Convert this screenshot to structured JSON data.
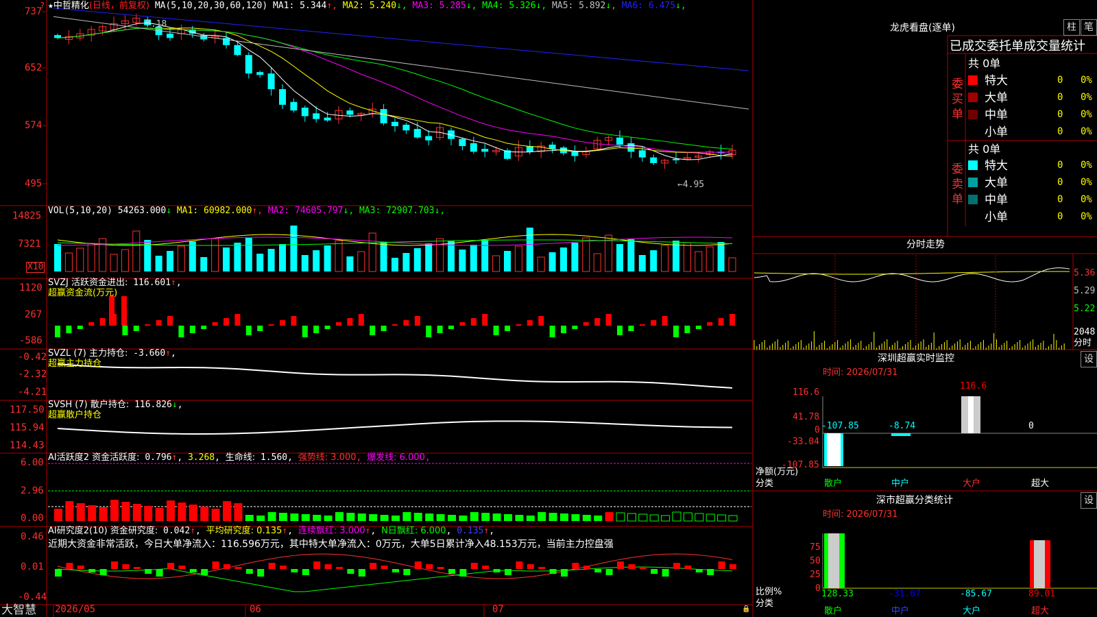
{
  "stock": {
    "star": "★",
    "name": "中哲精化",
    "mode": "(日线，前复权)"
  },
  "ma_header": {
    "label": "MA(5,10,20,30,60,120)",
    "items": [
      {
        "name": "MA1:",
        "value": "5.344",
        "arrow": "↑",
        "color": "#ffffff"
      },
      {
        "name": "MA2:",
        "value": "5.240",
        "arrow": "↓",
        "color": "#ffff00"
      },
      {
        "name": "MA3:",
        "value": "5.285",
        "arrow": "↓",
        "color": "#ff00ff"
      },
      {
        "name": "MA4:",
        "value": "5.326",
        "arrow": "↓",
        "color": "#00ff00"
      },
      {
        "name": "MA5:",
        "value": "5.892",
        "arrow": "↓",
        "color": "#c0c0c0"
      },
      {
        "name": "MA6:",
        "value": "6.475",
        "arrow": "↓",
        "color": "#2222ff"
      }
    ]
  },
  "price_axis": [
    "737",
    "652",
    "574",
    "495"
  ],
  "price_marks": {
    "high": "7.18",
    "low": "←4.95"
  },
  "vol_header": {
    "label": "VOL(5,10,20)",
    "value": "54263.000",
    "arrow": "↓",
    "items": [
      {
        "name": "MA1:",
        "value": "60982.000",
        "arrow": "↑",
        "color": "#ffff00"
      },
      {
        "name": "MA2:",
        "value": "74605.797",
        "arrow": "↓",
        "color": "#ff00ff"
      },
      {
        "name": "MA3:",
        "value": "72907.703",
        "arrow": "↓",
        "color": "#00ff00"
      }
    ]
  },
  "vol_axis": [
    "14825",
    "7321",
    "X10"
  ],
  "svzj": {
    "line1_label": "SVZJ  活跃资金进出:",
    "line1_value": "116.601",
    "line1_arrow": "↑",
    "line2": "超赢资金流(万元)",
    "axis": [
      "1120",
      "267",
      "-586"
    ]
  },
  "svzl": {
    "label": "SVZL (7) 主力持仓:",
    "value": "-3.660",
    "arrow": "↑",
    "line2": "超赢主力持仓",
    "axis": [
      "-0.42",
      "-2.32",
      "-4.21"
    ]
  },
  "svsh": {
    "label": "SVSH (7) 散户持仓:",
    "value": "116.826",
    "arrow": "↓",
    "line2": "超赢散户持仓",
    "axis": [
      "117.50",
      "115.94",
      "114.43"
    ]
  },
  "ai1": {
    "label": "AI活跃度2 资金活跃度:",
    "v1": "0.796",
    "v2": "3.268",
    "v3_label": "生命线:",
    "v3": "1.560",
    "v4": "强势线: 3.000",
    "v5": "爆发线: 6.000",
    "axis": [
      "6.00",
      "2.96",
      "0.00"
    ]
  },
  "ai2": {
    "label": "AI研究度2(10) 资金研究度:",
    "v1": "0.042",
    "v2": "平均研究度: 0.135",
    "v3": "连续飘红: 3.000",
    "v4": "N日飘红: 6.000",
    "v5": "0.135",
    "axis": [
      "0.46",
      "0.01",
      "-0.44"
    ],
    "comment": "近期大资金非常活跃，今日大单净流入：116.596万元，其中特大单净流入：0万元，大单5日累计净入48.153万元，当前主力控盘强"
  },
  "bottom": {
    "logo": "大智慧",
    "dates": [
      "2026/05",
      "06",
      "07"
    ]
  },
  "right": {
    "lhb_title": "龙虎看盘(逐单)",
    "btn_column": "柱",
    "btn_pen": "笔",
    "tabs": "已成交委托单成交量统计",
    "buy_side": "委买单",
    "sell_side": "委卖单",
    "buy_total": "共 0单",
    "sell_total": "共 0单",
    "buy_rows": [
      {
        "label": "特大",
        "count": "0",
        "pct": "0%",
        "color": "#ff0000"
      },
      {
        "label": "大单",
        "count": "0",
        "pct": "0%",
        "color": "#a00000"
      },
      {
        "label": "中单",
        "count": "0",
        "pct": "0%",
        "color": "#700000"
      },
      {
        "label": "小单",
        "count": "0",
        "pct": "0%",
        "color": "#000000"
      }
    ],
    "sell_rows": [
      {
        "label": "特大",
        "count": "0",
        "pct": "0%",
        "color": "#00ffff"
      },
      {
        "label": "大单",
        "count": "0",
        "pct": "0%",
        "color": "#00a0a0"
      },
      {
        "label": "中单",
        "count": "0",
        "pct": "0%",
        "color": "#007070"
      },
      {
        "label": "小单",
        "count": "0",
        "pct": "0%",
        "color": "#000000"
      }
    ],
    "intraday_title": "分时走势",
    "intraday_axis": [
      "5.36",
      "5.29",
      "5.22",
      "2048",
      "分时"
    ],
    "monitor_title": "深圳超赢实时监控",
    "monitor_set": "设",
    "monitor_time": "时间: 2026/07/31",
    "monitor_axis": [
      "116.6",
      "41.78",
      "0",
      "-33.04",
      "-107.85"
    ],
    "monitor_values": [
      {
        "label": "散户",
        "value": "-107.85",
        "color": "#00ffff"
      },
      {
        "label": "中户",
        "value": "-8.74",
        "color": "#00ffff"
      },
      {
        "label": "大户",
        "value": "116.6",
        "color": "#ff0000"
      },
      {
        "label": "超大",
        "value": "0",
        "color": "#ffffff"
      }
    ],
    "monitor_ylabel": "净额(万元)",
    "monitor_xlabel": "分类",
    "stats_title": "深市超赢分类统计",
    "stats_set": "设",
    "stats_time": "时间: 2026/07/31",
    "stats_axis": [
      "75",
      "50",
      "25",
      "0"
    ],
    "stats_values": [
      {
        "label": "散户",
        "value": "128.33",
        "color": "#00ff00"
      },
      {
        "label": "中户",
        "value": "-31.67",
        "color": "#0000ff"
      },
      {
        "label": "大户",
        "value": "-85.67",
        "color": "#00ffff"
      },
      {
        "label": "超大",
        "value": "89.01",
        "color": "#ff0000"
      }
    ],
    "stats_ylabel": "比例%",
    "stats_xlabel": "分类"
  }
}
